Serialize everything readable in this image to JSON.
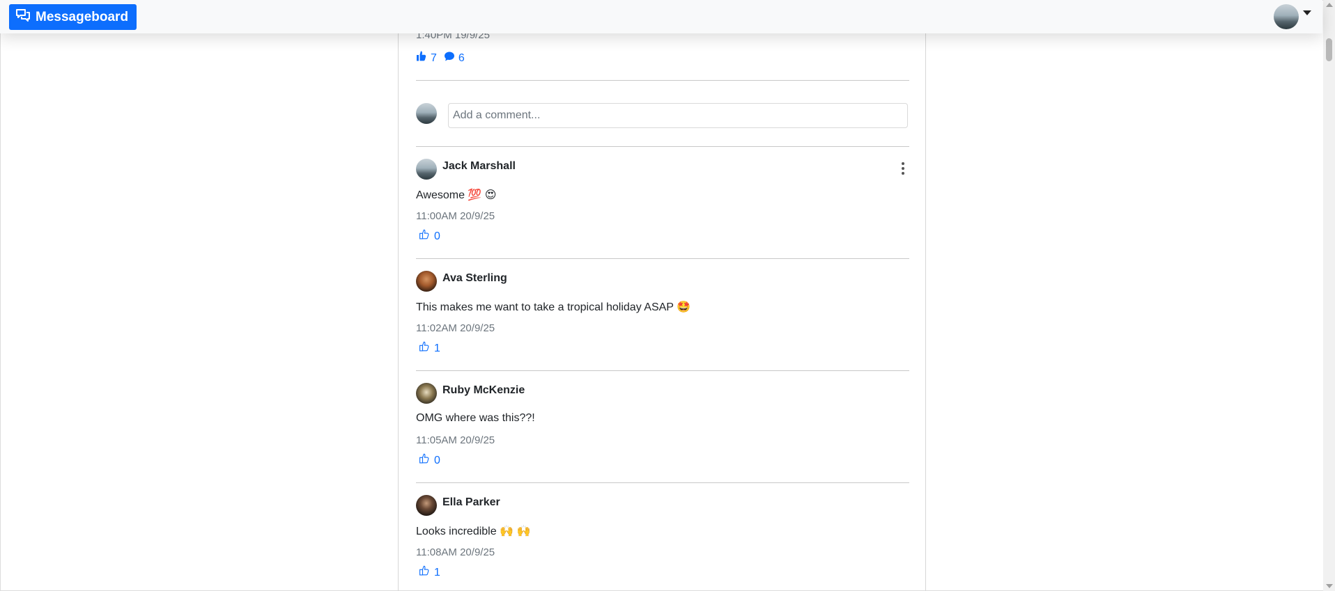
{
  "navbar": {
    "brand_label": "Messageboard",
    "brand_icon": "chat-bubbles-icon",
    "user_avatar": "user-avatar",
    "menu_caret": "caret-down-icon"
  },
  "post": {
    "timestamp": "1:40PM 19/9/25",
    "like_count": "7",
    "comment_count": "6"
  },
  "comment_form": {
    "placeholder": "Add a comment...",
    "value": ""
  },
  "comments": [
    {
      "author": "Jack Marshall",
      "text": "Awesome 💯 😍",
      "time": "11:00AM 20/9/25",
      "likes": "0",
      "has_menu": true
    },
    {
      "author": "Ava Sterling",
      "text": "This makes me want to take a tropical holiday ASAP 🤩",
      "time": "11:02AM 20/9/25",
      "likes": "1"
    },
    {
      "author": "Ruby McKenzie",
      "text": "OMG where was this??!",
      "time": "11:05AM 20/9/25",
      "likes": "0"
    },
    {
      "author": "Ella Parker",
      "text": "Looks incredible 🙌 🙌",
      "time": "11:08AM 20/9/25",
      "likes": "1"
    }
  ],
  "colors": {
    "accent": "#0d6efd",
    "muted": "#6c757d",
    "navbar_bg": "#f8f9fa"
  }
}
